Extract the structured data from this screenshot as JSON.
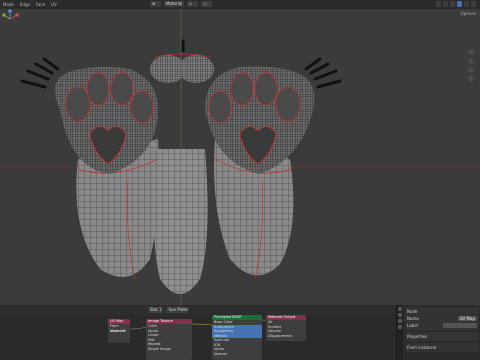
{
  "header": {
    "menus": [
      "Mode",
      "Edge",
      "Face",
      "UV"
    ],
    "viewport_shading": "Material",
    "right_icons": [
      "view-icon",
      "overlay-icon",
      "xray-icon",
      "solid-icon",
      "material-icon",
      "rendered-icon"
    ]
  },
  "viewport": {
    "options_label": "Options",
    "model": "3D mesh of paw feet with red UV seams",
    "colors": {
      "background": "#3b3b3b",
      "mesh": "#8c8c8c",
      "seam": "#cc2a2a",
      "wire": "#1e1e1e"
    }
  },
  "node_editor": {
    "header_label": "Slot 1",
    "slot_label": "Sun Plate",
    "nodes": {
      "uvmap": {
        "title": "UV Map",
        "rows": [
          "From Instancer",
          "Mesh UV"
        ]
      },
      "image": {
        "title": "Image Texture",
        "rows": [
          "Color",
          "Alpha",
          "Linear",
          "Flat",
          "Repeat",
          "Single Image"
        ]
      },
      "principled": {
        "title": "Principled BSDF",
        "rows": [
          "Base Color",
          "Subsurface",
          "Roughness",
          "Metallic",
          "Specular",
          "IOR",
          "Alpha",
          "Normal"
        ]
      },
      "output": {
        "title": "Material Output",
        "rows": [
          "All",
          "Surface",
          "Volume",
          "Displacement"
        ]
      }
    },
    "colors": {
      "uv_header": "#83314a",
      "image_header": "#83314a",
      "bsdf_header": "#1f6a3a",
      "output_header": "#83314a"
    }
  },
  "properties": {
    "section_node": "Node",
    "name_label": "Name",
    "name_value": "UV Map",
    "label_label": "Label",
    "section_properties": "Properties",
    "section_from": "From Instancer"
  }
}
